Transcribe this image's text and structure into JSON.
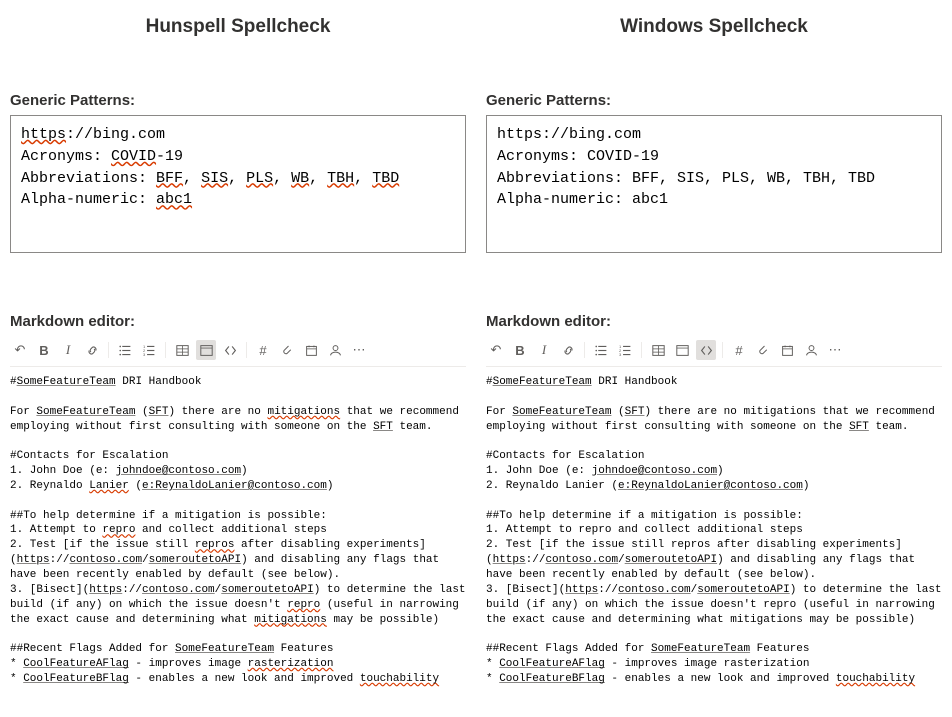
{
  "columns": [
    {
      "title": "Hunspell Spellcheck",
      "genericLabel": "Generic Patterns:",
      "generic": {
        "url_pre": "https",
        "url_post": "://bing.com",
        "url_pre_flag": true,
        "acronyms_label": "Acronyms:",
        "acronym_word": "COVID",
        "acronym_suffix": "-19",
        "acronym_word_flag": true,
        "abbrev_label": "Abbreviations:",
        "abbrev_items": [
          {
            "text": "BFF",
            "flag": true
          },
          {
            "text": "SIS",
            "flag": true
          },
          {
            "text": "PLS",
            "flag": true
          },
          {
            "text": "WB",
            "flag": true
          },
          {
            "text": "TBH",
            "flag": true
          },
          {
            "text": "TBD",
            "flag": true
          }
        ],
        "alnum_label": "Alpha-numeric:",
        "alnum_value": "abc1",
        "alnum_flag": true
      },
      "editorLabel": "Markdown editor:",
      "toolbarActive": "code",
      "md": {
        "flagged_SomeFeatureTeam": true,
        "flagged_SFT_paren": true,
        "flagged_mitigations": true,
        "flagged_Lanier": true,
        "flagged_repro": true,
        "flagged_someroutetoAPI": true,
        "flagged_contoso": true,
        "flagged_repros": true,
        "flagged_rasterization": true,
        "flagged_touchability": true,
        "flagged_CoolFeatureAFlag": true,
        "flagged_CoolFeatureBFlag": true
      }
    },
    {
      "title": "Windows Spellcheck",
      "genericLabel": "Generic Patterns:",
      "generic": {
        "url_pre": "https",
        "url_post": "://bing.com",
        "url_pre_flag": false,
        "acronyms_label": "Acronyms:",
        "acronym_word": "COVID",
        "acronym_suffix": "-19",
        "acronym_word_flag": false,
        "abbrev_label": "Abbreviations:",
        "abbrev_items": [
          {
            "text": "BFF",
            "flag": false
          },
          {
            "text": "SIS",
            "flag": false
          },
          {
            "text": "PLS",
            "flag": false
          },
          {
            "text": "WB",
            "flag": false
          },
          {
            "text": "TBH",
            "flag": false
          },
          {
            "text": "TBD",
            "flag": false
          }
        ],
        "alnum_label": "Alpha-numeric:",
        "alnum_value": "abc1",
        "alnum_flag": false
      },
      "editorLabel": "Markdown editor:",
      "toolbarActive": "preview",
      "md": {
        "flagged_SomeFeatureTeam": true,
        "flagged_SFT_paren": false,
        "flagged_mitigations": false,
        "flagged_Lanier": false,
        "flagged_repro": false,
        "flagged_someroutetoAPI": false,
        "flagged_contoso": false,
        "flagged_repros": false,
        "flagged_rasterization": false,
        "flagged_touchability": true,
        "flagged_CoolFeatureAFlag": true,
        "flagged_CoolFeatureBFlag": true
      }
    }
  ],
  "markdown_text": {
    "l1_pre": "#",
    "l1_word": "SomeFeatureTeam",
    "l1_post": " DRI Handbook",
    "l2_a": "For ",
    "l2_b": "SomeFeatureTeam",
    "l2_c": " (",
    "l2_d": "SFT",
    "l2_e": ") there are no ",
    "l2_f": "mitigations",
    "l2_g": " that we recommend employing without first consulting with someone on the ",
    "l2_h": "SFT",
    "l2_i": " team.",
    "l3": "#Contacts for Escalation",
    "l4_a": "1. John Doe (e: ",
    "l4_b": "johndoe@contoso.com",
    "l4_c": ")",
    "l5_a": "2. Reynaldo ",
    "l5_b": "Lanier",
    "l5_c": " (",
    "l5_d": "e:ReynaldoLanier@contoso.com",
    "l5_e": ")",
    "l6": "##To help determine if a mitigation is possible:",
    "l7_a": "1. Attempt to ",
    "l7_b": "repro",
    "l7_c": " and collect additional steps",
    "l8_a": "2. Test [if the issue still ",
    "l8_b": "repros",
    "l8_c": " after disabling experiments](",
    "l8_d": "https",
    "l8_e": "://",
    "l8_f": "contoso.com",
    "l8_g": "/",
    "l8_h": "someroutetoAPI",
    "l8_i": ") and disabling any flags that have been recently enabled by default (see below).",
    "l9_a": "3. [Bisect](",
    "l9_b1": "https",
    "l9_b2": "://",
    "l9_c": "contoso.com",
    "l9_c2": "/",
    "l9_d": "someroutetoAPI",
    "l9_e": ") to determine the last build (if any) on which the issue doesn't ",
    "l9_f": "repro",
    "l9_g": " (useful in narrowing the exact cause and determining what ",
    "l9_h": "mitigations",
    "l9_i": " may be possible)",
    "l10_a": "##Recent Flags Added for ",
    "l10_b": "SomeFeatureTeam",
    "l10_c": " Features",
    "l11_a": "* ",
    "l11_b": "CoolFeatureAFlag",
    "l11_c": " - improves image ",
    "l11_d": "rasterization",
    "l12_a": "* ",
    "l12_b": "CoolFeatureBFlag",
    "l12_c": " - enables a new look and improved ",
    "l12_d": "touchability"
  }
}
